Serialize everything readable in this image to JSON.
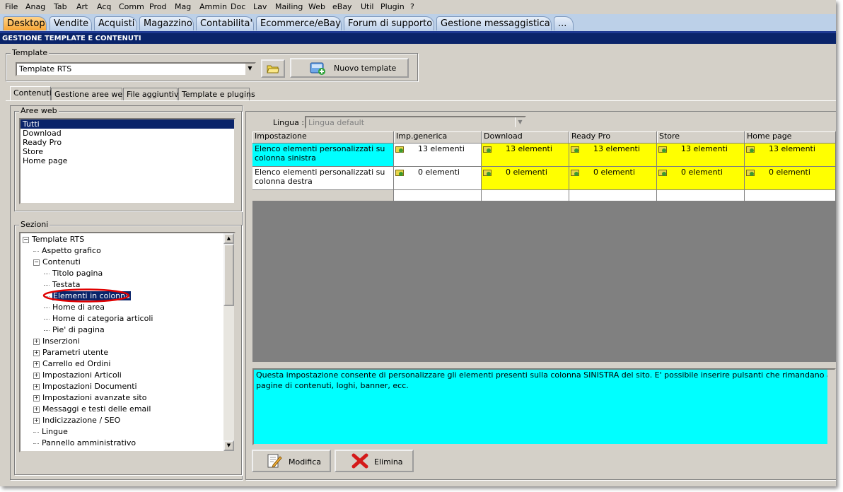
{
  "menu": [
    "File",
    "Anag",
    "Tab",
    "Art",
    "Acq",
    "Comm",
    "Prod",
    "Mag",
    "Ammin",
    "Doc",
    "Lav",
    "Mailing",
    "Web",
    "eBay",
    "Util",
    "Plugin",
    "?"
  ],
  "tabs": [
    "Desktop",
    "Vendite",
    "Acquisti",
    "Magazzino",
    "Contabilita'",
    "Ecommerce/eBay",
    "Forum di supporto",
    "Gestione messaggistica",
    "..."
  ],
  "active_tab": "Desktop",
  "title": "GESTIONE TEMPLATE E CONTENUTI",
  "template_group": {
    "legend": "Template",
    "selected": "Template RTS",
    "new_button": "Nuovo template"
  },
  "subtabs": [
    "Contenuti",
    "Gestione aree web",
    "File aggiuntivi",
    "Template e plugins"
  ],
  "aree_web": {
    "legend": "Aree web",
    "items": [
      "Tutti",
      "Download",
      "Ready Pro",
      "Store",
      "Home page"
    ],
    "selected": "Tutti"
  },
  "sezioni": {
    "legend": "Sezioni",
    "nodes": [
      {
        "label": "Template RTS",
        "level": 0,
        "toggle": "minus"
      },
      {
        "label": "Aspetto grafico",
        "level": 1,
        "toggle": "line"
      },
      {
        "label": "Contenuti",
        "level": 1,
        "toggle": "minus"
      },
      {
        "label": "Titolo pagina",
        "level": 2,
        "toggle": "line"
      },
      {
        "label": "Testata",
        "level": 2,
        "toggle": "line"
      },
      {
        "label": "Elementi in colonna",
        "level": 2,
        "toggle": "line",
        "selected": true
      },
      {
        "label": "Home di area",
        "level": 2,
        "toggle": "line"
      },
      {
        "label": "Home di categoria articoli",
        "level": 2,
        "toggle": "line"
      },
      {
        "label": "Pie' di pagina",
        "level": 2,
        "toggle": "line"
      },
      {
        "label": "Inserzioni",
        "level": 1,
        "toggle": "plus"
      },
      {
        "label": "Parametri utente",
        "level": 1,
        "toggle": "plus"
      },
      {
        "label": "Carrello ed Ordini",
        "level": 1,
        "toggle": "plus"
      },
      {
        "label": "Impostazioni Articoli",
        "level": 1,
        "toggle": "plus"
      },
      {
        "label": "Impostazioni Documenti",
        "level": 1,
        "toggle": "plus"
      },
      {
        "label": "Impostazioni avanzate sito",
        "level": 1,
        "toggle": "plus"
      },
      {
        "label": "Messaggi e testi delle email",
        "level": 1,
        "toggle": "plus"
      },
      {
        "label": "Indicizzazione / SEO",
        "level": 1,
        "toggle": "plus"
      },
      {
        "label": "Lingue",
        "level": 1,
        "toggle": "line"
      },
      {
        "label": "Pannello amministrativo",
        "level": 1,
        "toggle": "line"
      }
    ]
  },
  "lingua": {
    "label": "Lingua :",
    "value": "Lingua default"
  },
  "grid": {
    "columns": [
      "Impostazione",
      "Imp.generica",
      "Download",
      "Ready Pro",
      "Store",
      "Home page"
    ],
    "rows": [
      {
        "name": "Elenco elementi personalizzati su colonna sinistra",
        "values": [
          "13 elementi",
          "13 elementi",
          "13 elementi",
          "13 elementi",
          "13 elementi"
        ]
      },
      {
        "name": "Elenco elementi personalizzati su colonna destra",
        "values": [
          "0 elementi",
          "0 elementi",
          "0 elementi",
          "0 elementi",
          "0 elementi"
        ]
      }
    ]
  },
  "description": "Questa impostazione consente di personalizzare gli elementi presenti sulla colonna SINISTRA del sito. E' possibile inserire pulsanti che rimandano a pagine di contenuti, loghi, banner, ecc.",
  "buttons": {
    "modify": "Modifica",
    "delete": "Elimina"
  },
  "colors": {
    "highlight_cyan": "#00ffff",
    "highlight_yellow": "#ffff00",
    "selection": "#0a246a",
    "active_tab": "#f7a534",
    "annotation_red": "#e00000"
  }
}
